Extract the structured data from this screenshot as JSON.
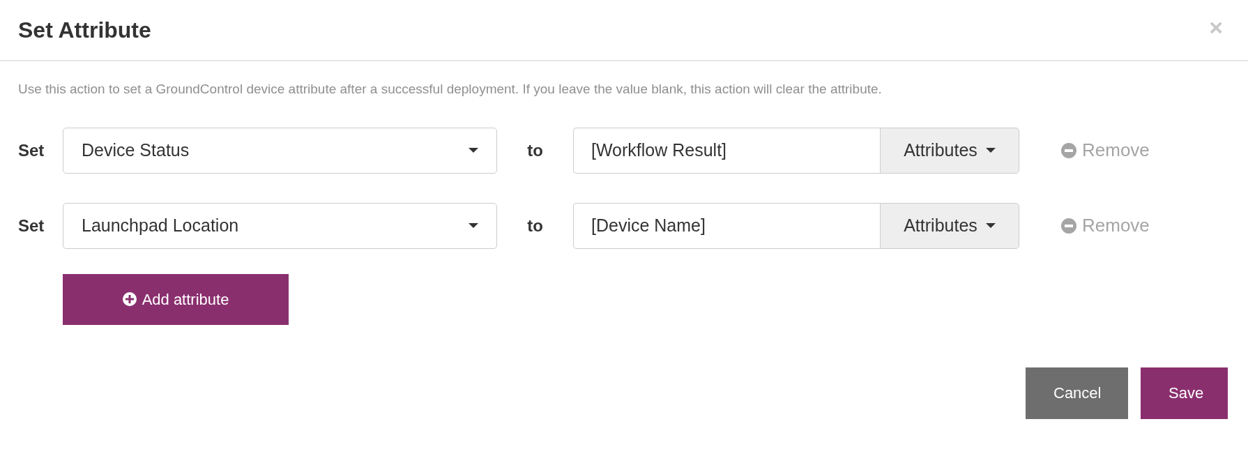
{
  "dialog": {
    "title": "Set Attribute",
    "close": "×"
  },
  "description": "Use this action to set a GroundControl device attribute after a successful deployment. If you leave the value blank, this action will clear the attribute.",
  "rows": [
    {
      "label": "Set",
      "attribute": "Device Status",
      "connector": "to",
      "value": "[Workflow Result]",
      "addon": "Attributes",
      "remove": "Remove"
    },
    {
      "label": "Set",
      "attribute": "Launchpad Location",
      "connector": "to",
      "value": "[Device Name]",
      "addon": "Attributes",
      "remove": "Remove"
    }
  ],
  "add_button": "Add attribute",
  "buttons": [
    {
      "label": "Cancel",
      "kind": "secondary"
    },
    {
      "label": "Save",
      "kind": "primary"
    }
  ]
}
